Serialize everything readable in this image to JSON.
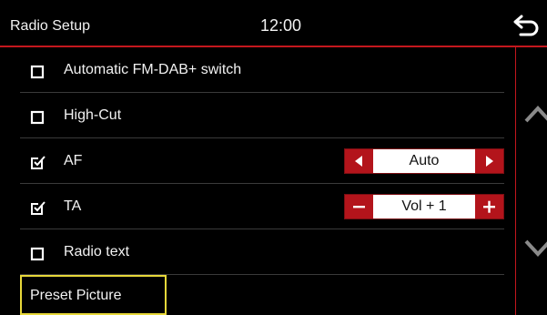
{
  "header": {
    "title": "Radio Setup",
    "time": "12:00",
    "back_icon": "back-arrow-icon"
  },
  "settings": [
    {
      "label": "Automatic FM-DAB+ switch",
      "checked": false
    },
    {
      "label": "High-Cut",
      "checked": false
    },
    {
      "label": "AF",
      "checked": true,
      "control": {
        "type": "arrows",
        "value": "Auto",
        "left_icon": "triangle-left-icon",
        "right_icon": "triangle-right-icon"
      }
    },
    {
      "label": "TA",
      "checked": true,
      "control": {
        "type": "stepper",
        "value": "Vol + 1",
        "left_icon": "minus-icon",
        "right_icon": "plus-icon"
      }
    },
    {
      "label": "Radio text",
      "checked": false
    }
  ],
  "selected_item": {
    "label": "Preset Picture"
  },
  "scroll": {
    "up_icon": "chevron-up-icon",
    "down_icon": "chevron-down-icon"
  },
  "colors": {
    "accent": "#c4171d",
    "button": "#b3141b",
    "selection": "#e7d83a",
    "background": "#000000"
  }
}
